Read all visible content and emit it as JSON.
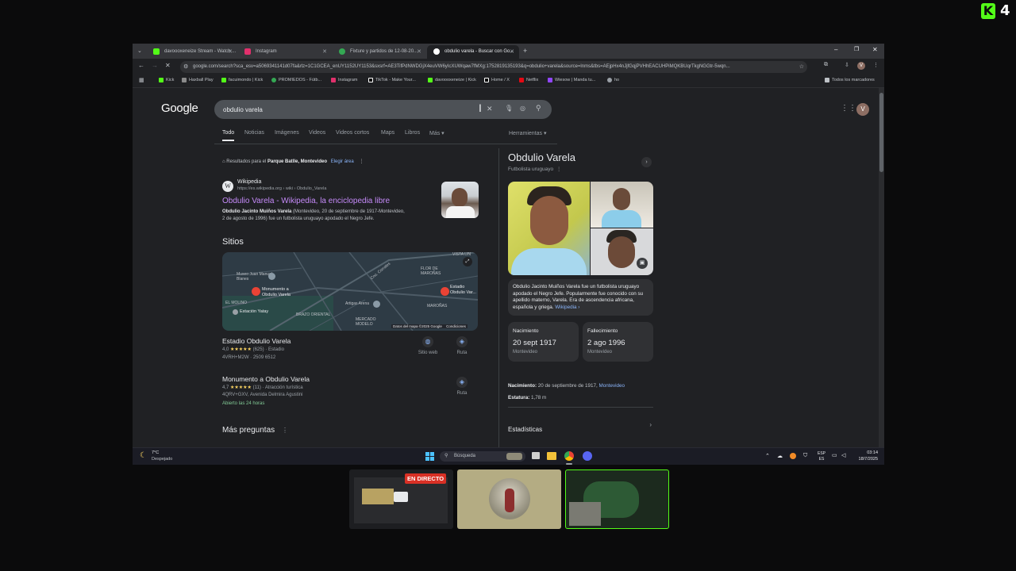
{
  "overlay": {
    "kick_logo": "K",
    "viewer_count": "4",
    "live_badge": "EN DIRECTO"
  },
  "browser": {
    "tabs": [
      {
        "label": "davoooxeneize Stream - Watch ...",
        "color": "#53fc18"
      },
      {
        "label": "Instagram",
        "color": "#e1306c"
      },
      {
        "label": "Fixture y partidos de 12-08-20...",
        "color": "#34a853"
      },
      {
        "label": "obdulio varela - Buscar con Go...",
        "color": "#ffffff"
      }
    ],
    "url": "google.com/search?sca_esv=a5069341141d07fa&rlz=1C1GCEA_enUY1152UY1153&sxsrf=AE3TifPdNWDGjX4euVW6yIcXUWqaw7fMXg:1752819135193&q=obdulio+varela&source=lnms&tbs=AEjpHx4nJjfGqjPVHhEACUHPiMQKBUqrTkgNGGtr-5wqn...",
    "bookmarks": [
      {
        "label": "Kick",
        "color": "#53fc18"
      },
      {
        "label": "Haxball Play",
        "color": "#8a8a8a"
      },
      {
        "label": "facuimondo | Kick",
        "color": "#53fc18"
      },
      {
        "label": "PROMIEDOS - Fútb...",
        "color": "#34a853"
      },
      {
        "label": "Instagram",
        "color": "#e1306c"
      },
      {
        "label": "TikTok - Make Your...",
        "color": "#ffffff"
      },
      {
        "label": "davoooxeneize | Kick",
        "color": "#53fc18"
      },
      {
        "label": "Home / X",
        "color": "#ffffff"
      },
      {
        "label": "Netflix",
        "color": "#e50914"
      },
      {
        "label": "Wiesow | Manda tu...",
        "color": "#9146ff"
      },
      {
        "label": "ho",
        "color": "#9aa0a6"
      }
    ],
    "all_bookmarks": "Todos los marcadores"
  },
  "google": {
    "logo": "Google",
    "query": "obdulio varela",
    "filters": [
      "Todo",
      "Noticias",
      "Imágenes",
      "Videos",
      "Videos cortos",
      "Maps",
      "Libros",
      "Más"
    ],
    "tools": "Herramientas",
    "location_prefix": "Resultados para el",
    "location": "Parque Batlle, Montevideo",
    "location_link": "Elegir área",
    "wiki": {
      "site": "Wikipedia",
      "url": "https://es.wikipedia.org › wiki › Obdulio_Varela",
      "title": "Obdulio Varela - Wikipedia, la enciclopedia libre",
      "snippet_bold": "Obdulio Jacinto Muiños Varela",
      "snippet_line1": " (Montevideo, 20 de septiembre de 1917-Montevideo,",
      "snippet_line2": "2 de agosto de 1996) fue un futbolista uruguayo apodado el Negro Jefe."
    },
    "sitios_heading": "Sitios",
    "map": {
      "labels": {
        "museo": "Museo Juan Manuel Blanes",
        "monumento": "Monumento a Obdulio Varela",
        "molino": "EL MOLINO",
        "estacion": "Estación Yatay",
        "brazo": "BRAZO ORIENTAL",
        "artigas": "Artigas Arena",
        "mercado": "MERCADO MODELO",
        "flor": "FLOR DE MAROÑAS",
        "estadio": "Estadio Obdulio Var...",
        "marona": "MAROÑAS",
        "vista": "VISTA LIN",
        "camino": "Cno. Corrales"
      },
      "attribution": "Datos del mapa ©2025 Google",
      "terms": "Condiciones"
    },
    "places": [
      {
        "name": "Estadio Obdulio Varela",
        "rating": "4,0",
        "stars": "★★★★★",
        "reviews": "(625)",
        "type": "Estadio",
        "address": "4VRH+M2W · 2509 6512",
        "open": "",
        "actions": [
          "Sitio web",
          "Ruta"
        ]
      },
      {
        "name": "Monumento a Obdulio Varela",
        "rating": "4,7",
        "stars": "★★★★★",
        "reviews": "(11)",
        "type": "Atracción turística",
        "address": "4QRV+GXV, Avenida Delmira Agustini",
        "open": "Abierto las 24 horas",
        "actions": [
          "Ruta"
        ]
      }
    ],
    "more_questions": "Más preguntas",
    "kp": {
      "name": "Obdulio Varela",
      "subtitle": "Futbolista uruguayo",
      "description": "Obdulio Jacinto Muiños Varela fue un futbolista uruguayo apodado el Negro Jefe. Popularmente fue conocido con su apellido materno, Varela. Era de ascendencia africana, española y griega.",
      "wiki_link": "Wikipedia",
      "birth_label": "Nacimiento",
      "birth_date": "20 sept 1917",
      "birth_place": "Montevideo",
      "death_label": "Fallecimiento",
      "death_date": "2 ago 1996",
      "death_place": "Montevideo",
      "fact1_label": "Nacimiento:",
      "fact1_value": " 20 de septiembre de 1917, ",
      "fact1_link": "Montevideo",
      "fact2_label": "Estatura:",
      "fact2_value": " 1,78 m",
      "stats": "Estadísticas"
    },
    "avatar_letter": "V"
  },
  "taskbar": {
    "temp": "7°C",
    "weather": "Despejado",
    "search": "Búsqueda",
    "lang1": "ESP",
    "lang2": "ES",
    "time": "03:14",
    "date": "18/7/2025"
  }
}
